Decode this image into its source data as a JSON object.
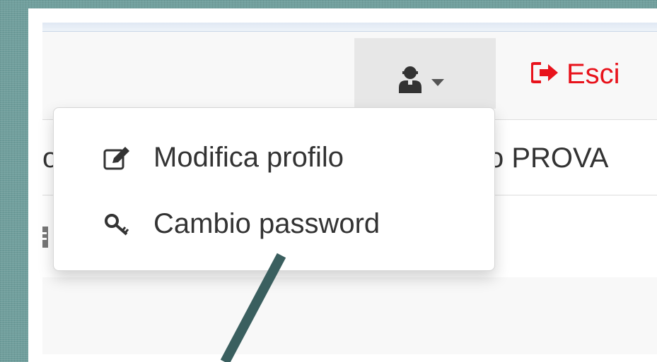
{
  "navbar": {
    "user_menu": {
      "icon": "user-icon",
      "caret": "caret-down-icon"
    },
    "logout": {
      "label": "Esci",
      "icon": "sign-out-icon",
      "color": "#e8131c"
    }
  },
  "background_rows": {
    "row1_left": "o",
    "row1_right": "o PROVA",
    "row2_left_icon": "calendar-icon"
  },
  "dropdown": {
    "items": [
      {
        "label": "Modifica profilo",
        "icon": "edit-icon"
      },
      {
        "label": "Cambio password",
        "icon": "key-icon"
      }
    ]
  },
  "colors": {
    "accent_red": "#e8131c",
    "annotation_line": "#3a5f5f",
    "frame_background": "#6f9e9c"
  }
}
